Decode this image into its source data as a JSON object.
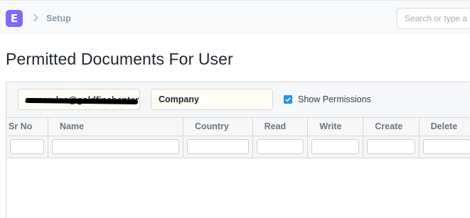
{
  "app": {
    "logo_letter": "E"
  },
  "breadcrumb": {
    "items": [
      "Setup"
    ]
  },
  "search": {
    "placeholder": "Search or type a command"
  },
  "page": {
    "title": "Permitted Documents For User"
  },
  "filters": {
    "user_value": "amson.lee@goldfinchenterprise.com",
    "doctype_value": "Company",
    "show_permissions_label": "Show Permissions",
    "show_permissions_checked": true
  },
  "table": {
    "columns": [
      "Sr No",
      "Name",
      "Country",
      "Read",
      "Write",
      "Create",
      "Delete"
    ],
    "rows": []
  },
  "colors": {
    "accent": "#2490ef",
    "logo_bg": "#8268f5",
    "field_bg": "#fffdf4"
  }
}
